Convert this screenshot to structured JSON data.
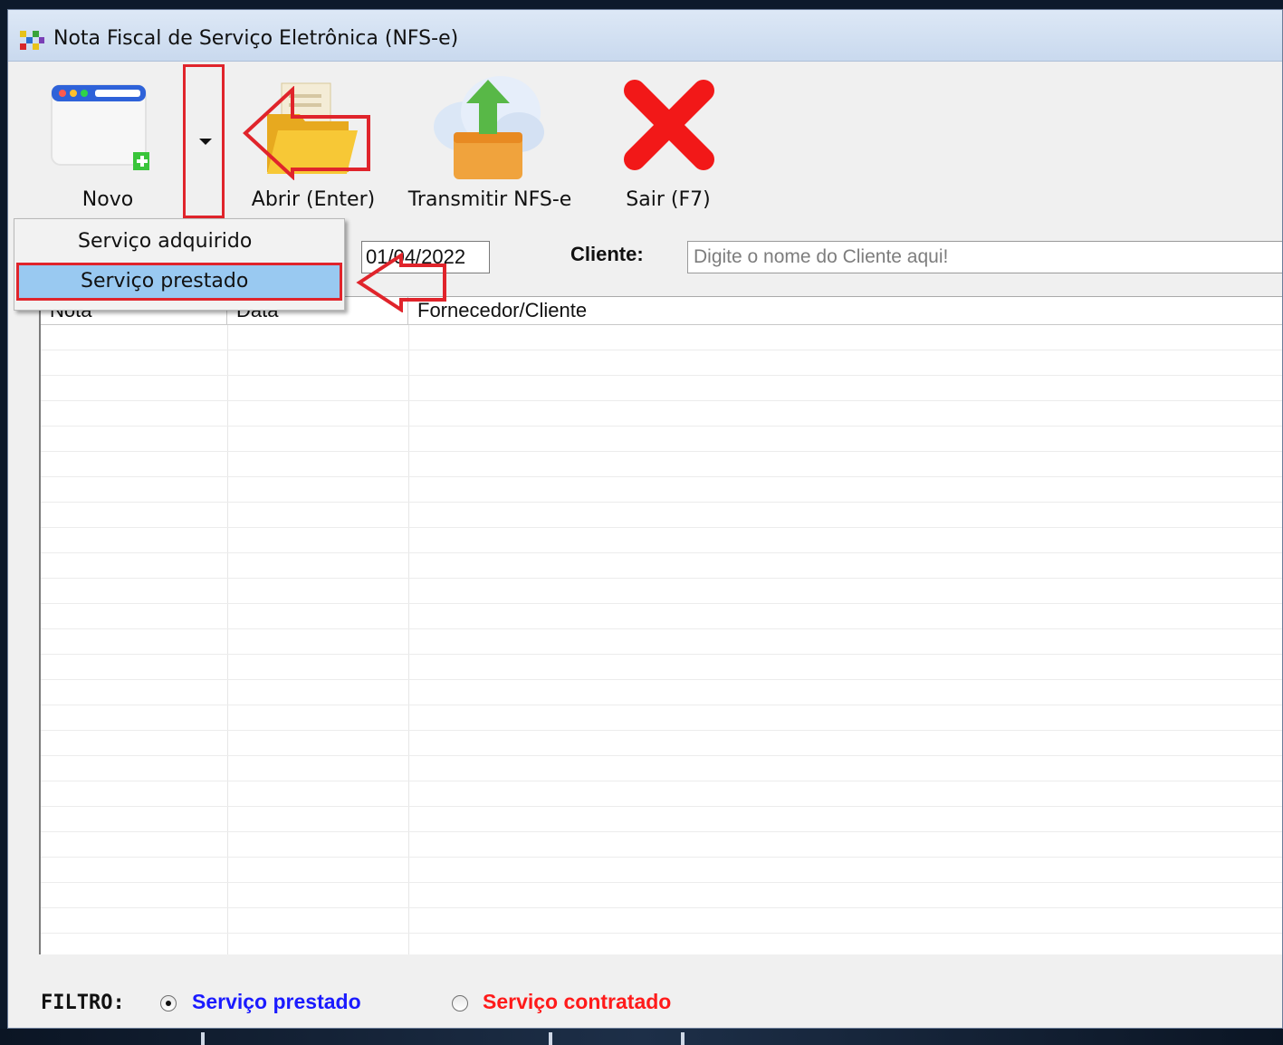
{
  "window": {
    "title": "Nota Fiscal de Serviço Eletrônica (NFS-e)"
  },
  "toolbar": {
    "novo_label": "Novo",
    "abrir_label": "Abrir (Enter)",
    "transmitir_label": "Transmitir NFS-e",
    "sair_label": "Sair (F7)",
    "icons": {
      "novo": "new-window-icon",
      "dropdown": "caret-down-icon",
      "abrir": "open-folder-icon",
      "transmitir": "cloud-upload-icon",
      "sair": "red-x-icon"
    }
  },
  "novo_menu": {
    "items": [
      {
        "label": "Serviço adquirido",
        "selected": false
      },
      {
        "label": "Serviço prestado",
        "selected": true
      }
    ]
  },
  "filters": {
    "date_value": "01/04/2022",
    "client_label": "Cliente:",
    "client_placeholder": "Digite o nome do Cliente aqui!"
  },
  "table": {
    "columns": [
      "Nota",
      "Data",
      "Fornecedor/Cliente"
    ],
    "rows": []
  },
  "footer": {
    "filtro_label": "FILTRO:",
    "options": [
      {
        "label": "Serviço prestado",
        "checked": true,
        "color": "#1a1aff"
      },
      {
        "label": "Serviço contratado",
        "checked": false,
        "color": "#ff1a1a"
      }
    ]
  },
  "colors": {
    "annotation_red": "#e0242b",
    "menu_selected_bg": "#99c9f1"
  }
}
